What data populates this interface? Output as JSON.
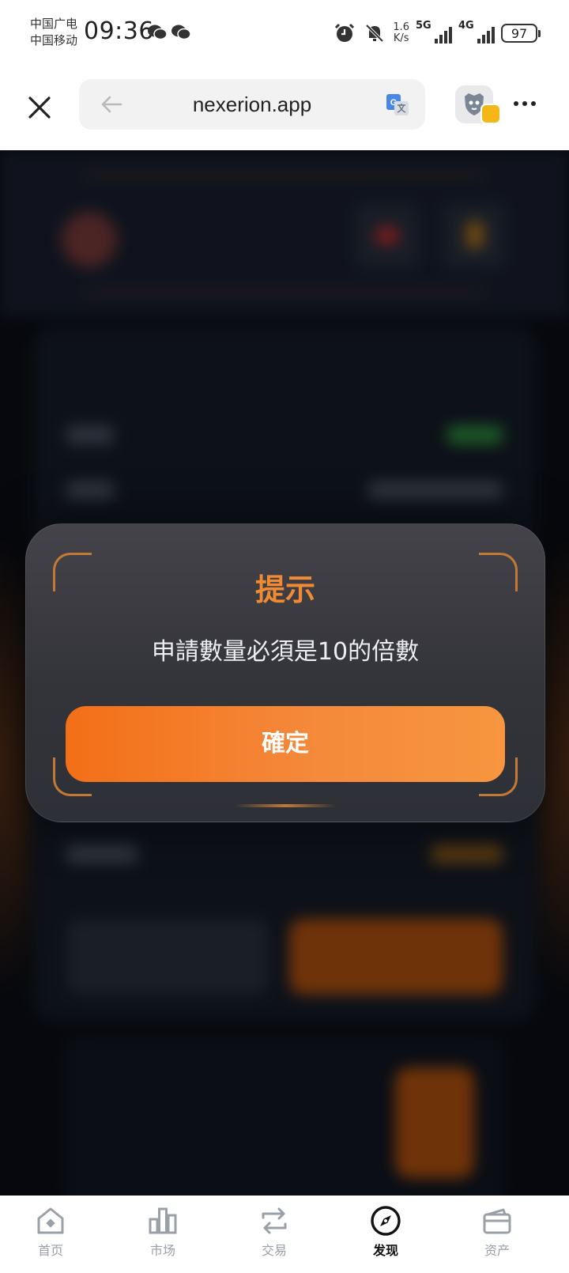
{
  "status_bar": {
    "carrier_1": "中国广电",
    "carrier_2": "中国移动",
    "time": "09:36",
    "net_speed_value": "1.6",
    "net_speed_unit": "K/s",
    "network_1": "5G",
    "network_2": "4G",
    "battery": "97",
    "icons": [
      "wechat-icon",
      "wechat-icon",
      "alarm-icon",
      "mute-icon",
      "signal-icon",
      "signal-icon",
      "battery-icon"
    ]
  },
  "browser": {
    "url": "nexerion.app",
    "icons": [
      "close-icon",
      "back-arrow-icon",
      "translate-icon",
      "extension-icon",
      "more-icon"
    ]
  },
  "dialog": {
    "title": "提示",
    "message": "申請數量必須是10的倍數",
    "confirm_label": "確定"
  },
  "colors": {
    "accent": "#f08a33",
    "button_start": "#f36f17",
    "button_end": "#f7963f",
    "dialog_bg": "#3a3a40"
  },
  "tabbar": {
    "tabs": [
      {
        "label": "首页",
        "icon": "home-icon",
        "active": false
      },
      {
        "label": "市场",
        "icon": "market-icon",
        "active": false
      },
      {
        "label": "交易",
        "icon": "trade-icon",
        "active": false
      },
      {
        "label": "发现",
        "icon": "compass-icon",
        "active": true
      },
      {
        "label": "资产",
        "icon": "wallet-icon",
        "active": false
      }
    ]
  }
}
